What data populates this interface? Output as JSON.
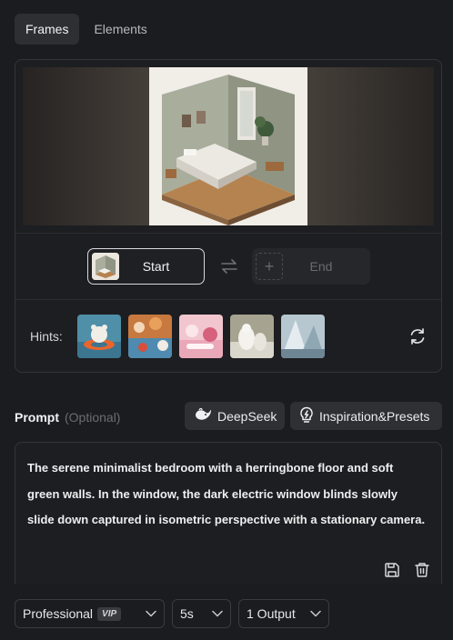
{
  "tabs": [
    {
      "label": "Frames",
      "active": true
    },
    {
      "label": "Elements",
      "active": false
    }
  ],
  "frames": {
    "start_label": "Start",
    "end_label": "End",
    "end_plus": "+",
    "hints_label": "Hints:",
    "hint_images": [
      "polar-bear-float",
      "food-feast",
      "pink-sweets",
      "white-animals-snow",
      "ice-architecture"
    ]
  },
  "prompt": {
    "title": "Prompt",
    "optional": "(Optional)",
    "deepseek_label": "DeepSeek",
    "inspiration_label": "Inspiration&Presets",
    "text": "The serene minimalist bedroom with a herringbone floor and soft green walls. In the window, the dark electric window blinds slowly slide down captured in isometric perspective with a stationary camera."
  },
  "settings": {
    "quality": "Professional",
    "vip_badge": "VIP",
    "duration": "5s",
    "outputs": "1 Output"
  },
  "colors": {
    "background": "#1b1c1f",
    "panel_border": "#34353a",
    "button_bg": "#2f3034"
  }
}
